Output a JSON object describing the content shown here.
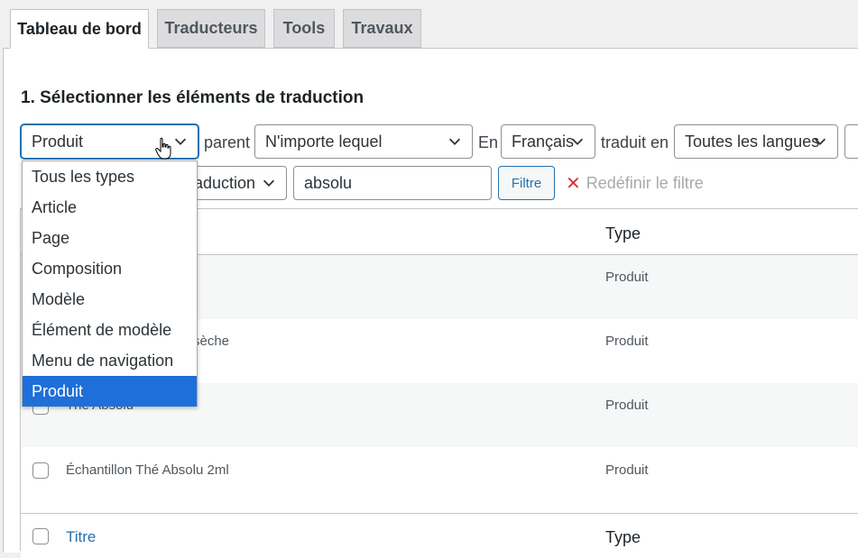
{
  "tabs": [
    {
      "label": "Tableau de bord",
      "active": true
    },
    {
      "label": "Traducteurs"
    },
    {
      "label": "Tools"
    },
    {
      "label": "Travaux"
    }
  ],
  "section_title": "1. Sélectionner les éléments de traduction",
  "filters": {
    "type_select": "Produit",
    "parent_label": "parent",
    "parent_select": "N'importe lequel",
    "in_label": "En",
    "language_select": "Français",
    "translated_label": "traduit en",
    "target_select": "Toutes les langues",
    "status_select_partial": "aduction",
    "search_value": "absolu",
    "filter_button": "Filtre",
    "reset_label": "Redéfinir le filtre"
  },
  "dropdown": {
    "options": [
      "Tous les types",
      "Article",
      "Page",
      "Composition",
      "Modèle",
      "Élément de modèle",
      "Menu de navigation",
      "Produit"
    ],
    "selected": "Produit"
  },
  "table": {
    "header_type": "Type",
    "rows": [
      {
        "title": "",
        "type": "Produit"
      },
      {
        "title": "sèche",
        "type": "Produit"
      },
      {
        "title": "Thé Absolu",
        "type": "Produit"
      },
      {
        "title": "Échantillon Thé Absolu 2ml",
        "type": "Produit"
      }
    ],
    "footer_title": "Titre",
    "footer_type": "Type"
  }
}
